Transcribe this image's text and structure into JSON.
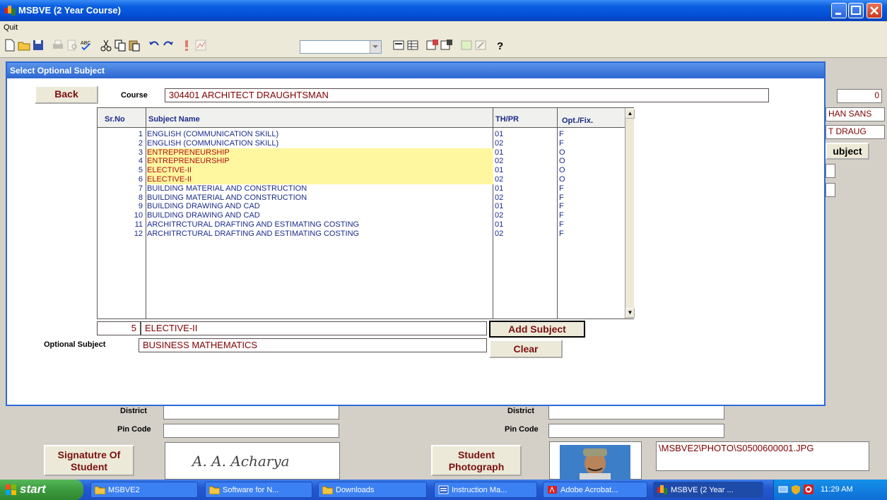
{
  "window": {
    "title": "MSBVE (2 Year Course)"
  },
  "menu": {
    "quit": "Quit"
  },
  "toolbar": {
    "combo_value": ""
  },
  "dialog": {
    "title": "Select Optional Subject",
    "back_label": "Back",
    "course_label": "Course",
    "course_value": "304401 ARCHITECT DRAUGHTSMAN",
    "grid": {
      "headers": {
        "srno": "Sr.No",
        "subject": "Subject Name",
        "thpr": "TH/PR",
        "opt": "Opt./Fix."
      },
      "rows": [
        {
          "srno": "1",
          "subject": "ENGLISH (COMMUNICATION SKILL)",
          "thpr": "01",
          "opt": "F",
          "highlight": false
        },
        {
          "srno": "2",
          "subject": "ENGLISH (COMMUNICATION SKILL)",
          "thpr": "02",
          "opt": "F",
          "highlight": false
        },
        {
          "srno": "3",
          "subject": "ENTREPRENEURSHIP",
          "thpr": "01",
          "opt": "O",
          "highlight": true
        },
        {
          "srno": "4",
          "subject": "ENTREPRENEURSHIP",
          "thpr": "02",
          "opt": "O",
          "highlight": true
        },
        {
          "srno": "5",
          "subject": "ELECTIVE-II",
          "thpr": "01",
          "opt": "O",
          "highlight": true
        },
        {
          "srno": "6",
          "subject": "ELECTIVE-II",
          "thpr": "02",
          "opt": "O",
          "highlight": true
        },
        {
          "srno": "7",
          "subject": "BUILDING MATERIAL AND CONSTRUCTION",
          "thpr": "01",
          "opt": "F",
          "highlight": false
        },
        {
          "srno": "8",
          "subject": "BUILDING MATERIAL AND CONSTRUCTION",
          "thpr": "02",
          "opt": "F",
          "highlight": false
        },
        {
          "srno": "9",
          "subject": "BUILDING DRAWING AND CAD",
          "thpr": "01",
          "opt": "F",
          "highlight": false
        },
        {
          "srno": "10",
          "subject": "BUILDING DRAWING AND CAD",
          "thpr": "02",
          "opt": "F",
          "highlight": false
        },
        {
          "srno": "11",
          "subject": "ARCHITRCTURAL DRAFTING AND ESTIMATING COSTING",
          "thpr": "01",
          "opt": "F",
          "highlight": false
        },
        {
          "srno": "12",
          "subject": "ARCHITRCTURAL DRAFTING AND ESTIMATING COSTING",
          "thpr": "02",
          "opt": "F",
          "highlight": false
        }
      ]
    },
    "selected_srno": "5",
    "selected_subject": "ELECTIVE-II",
    "add_subject_label": "Add Subject",
    "optional_subject_label": "Optional Subject",
    "optional_subject_value": "BUSINESS MATHEMATICS",
    "clear_label": "Clear"
  },
  "background_form": {
    "count_value": "0",
    "name_partial": "HAN SANS",
    "course_partial": "T DRAUG",
    "subject_button_partial": "ubject",
    "district_label": "District",
    "pin_code_label": "Pin Code",
    "district_value_1": "",
    "district_value_2": "",
    "pin_value_1": "",
    "pin_value_2": "",
    "signature_button": "Signatutre Of Student",
    "signature_text": "A. A. Acharya",
    "photo_button": "Student Photograph",
    "photo_path": "\\MSBVE2\\PHOTO\\S0500600001.JPG"
  },
  "taskbar": {
    "start": "start",
    "tasks": [
      {
        "label": "MSBVE2",
        "icon": "folder-icon"
      },
      {
        "label": "Software for N...",
        "icon": "folder-icon"
      },
      {
        "label": "Downloads",
        "icon": "folder-icon"
      },
      {
        "label": "Instruction Ma...",
        "icon": "word-icon"
      },
      {
        "label": "Adobe Acrobat...",
        "icon": "acrobat-icon"
      },
      {
        "label": "MSBVE (2 Year ...",
        "icon": "app-icon"
      }
    ],
    "clock": "11:29 AM"
  }
}
